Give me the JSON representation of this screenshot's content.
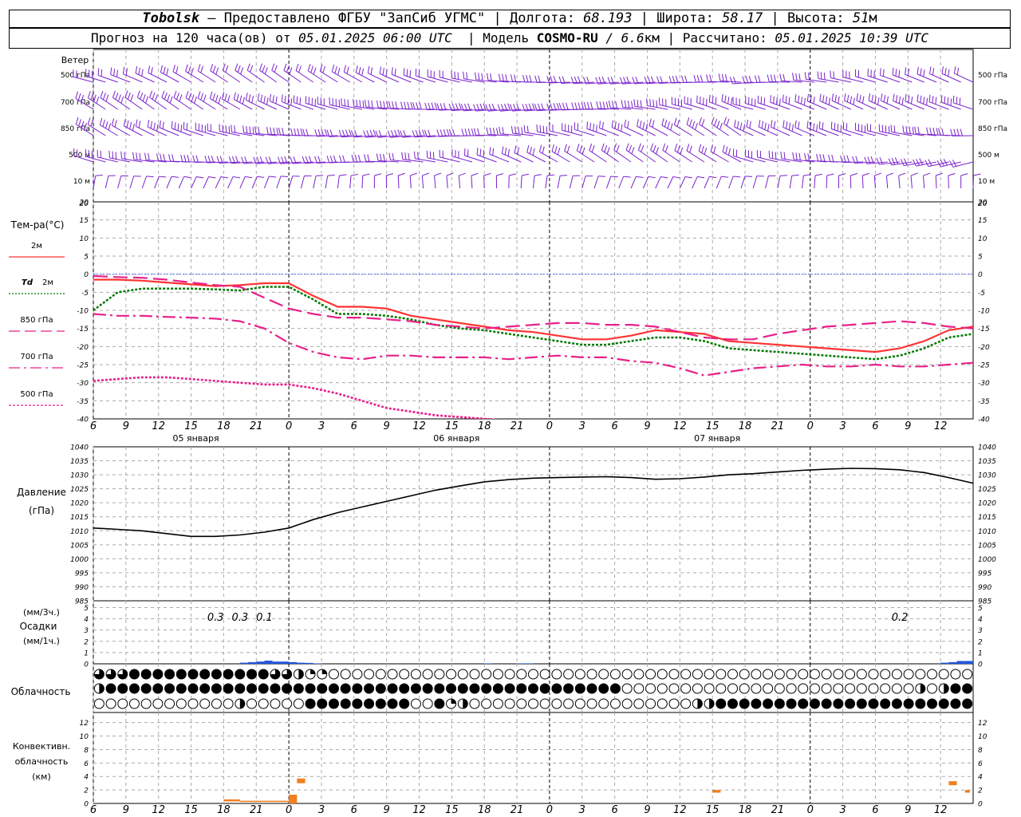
{
  "header": {
    "station": "Tobolsk",
    "dash": " — ",
    "provider": "Предоставлено ФГБУ \"ЗапСиб УГМС\"",
    "lon_label": "Долгота: ",
    "lon": "68.193",
    "lat_label": "Широта: ",
    "lat": "58.17",
    "alt_label": "Высота: ",
    "alt": "51",
    "alt_unit": "м",
    "forecast_label": "Прогноз на 120 часа(ов) от ",
    "forecast_start": "05.01.2025 06:00 UTC",
    "model_label": "Модель ",
    "model": "COSMO-RU",
    "model_res": " / 6.6",
    "model_res_unit": "км",
    "calc_label": "Рассчитано: ",
    "calc_time": "05.01.2025 10:39 UTC"
  },
  "colors": {
    "t2m": "#ff3333",
    "td2m": "#007700",
    "t850": "#e8208a",
    "t700": "#e8208a",
    "t500": "#e8208a",
    "wind": "#7a22cc",
    "pressure": "#000000",
    "precip": "#2255dd",
    "convective": "#f08020",
    "grid": "#aaaaaa",
    "zero_line": "#5566ff"
  },
  "wind_panel": {
    "title": "Ветер",
    "levels": [
      "500 гПа",
      "700 гПа",
      "850 гПа",
      "500 м",
      "10 м"
    ],
    "icon": "wind-barb-icon"
  },
  "time_axis": {
    "ticks": [
      "6",
      "9",
      "12",
      "15",
      "18",
      "21",
      "0",
      "3",
      "6",
      "9",
      "12",
      "15",
      "18",
      "21",
      "0",
      "3",
      "6",
      "9",
      "12",
      "15",
      "18",
      "21",
      "0",
      "3",
      "6",
      "9",
      "12"
    ],
    "days": [
      {
        "label": "05 января",
        "tick_index": 3
      },
      {
        "label": "06 января",
        "tick_index": 11
      },
      {
        "label": "07 января",
        "tick_index": 19
      }
    ],
    "midnight_tick_indices": [
      6,
      14,
      22
    ]
  },
  "temp_panel": {
    "title": "Тем-ра(°C)",
    "legend": [
      {
        "label": "2м",
        "style": "solid",
        "color_key": "t2m"
      },
      {
        "label": "Td",
        "suffix": "2м",
        "style": "dotted",
        "color_key": "td2m"
      },
      {
        "label": "850 гПа",
        "style": "dashed",
        "color_key": "t850"
      },
      {
        "label": "700 гПа",
        "style": "dashdot",
        "color_key": "t700"
      },
      {
        "label": "500 гПа",
        "style": "finedot",
        "color_key": "t500"
      }
    ],
    "yticks": [
      20,
      15,
      10,
      5,
      0,
      -5,
      -10,
      -15,
      -20,
      -25,
      -30,
      -35,
      -40
    ]
  },
  "pressure_panel": {
    "title": "Давление",
    "unit": "(гПа)",
    "yticks": [
      1040,
      1035,
      1030,
      1025,
      1020,
      1015,
      1010,
      1005,
      1000,
      995,
      990,
      985
    ]
  },
  "precip_panel": {
    "unit_top": "(мм/3ч.)",
    "title": "Осадки",
    "unit_bottom": "(мм/1ч.)",
    "yticks": [
      5,
      4,
      3,
      2,
      1,
      0
    ],
    "annotations": [
      {
        "hour": 21,
        "text": "0.3"
      },
      {
        "hour": 24,
        "text": "0.3"
      },
      {
        "hour": 27,
        "text": "0.1"
      },
      {
        "hour": 105,
        "text": "0.2"
      }
    ]
  },
  "cloud_panel": {
    "title": "Облачность",
    "icon": "cloud-cover-icon"
  },
  "convective_panel": {
    "title_1": "Конвективн.",
    "title_2": "облачность",
    "unit": "(км)",
    "yticks": [
      12,
      10,
      8,
      6,
      4,
      2,
      0
    ]
  },
  "chart_data": [
    {
      "type": "line",
      "title": "Тем-ра(°C)",
      "x_unit": "hours since 05.01.2025 06:00 UTC",
      "ylim": [
        -40,
        20
      ],
      "grid": true,
      "series": [
        {
          "name": "2м",
          "x": [
            0,
            3,
            6,
            9,
            12,
            15,
            18,
            21,
            24,
            27,
            30,
            33,
            36,
            39,
            42,
            45,
            48,
            51,
            54,
            57,
            60,
            63,
            66,
            69,
            72,
            75,
            78,
            81,
            84,
            87,
            90,
            93,
            96,
            99,
            102,
            105,
            108
          ],
          "values": [
            -1.5,
            -1.5,
            -1.8,
            -2.3,
            -2.8,
            -3.3,
            -3.0,
            -2.5,
            -2.5,
            -6,
            -9,
            -9,
            -9.5,
            -11.5,
            -12.5,
            -13.5,
            -14.5,
            -15.5,
            -16,
            -17,
            -18,
            -18,
            -17,
            -15.5,
            -16,
            -16.5,
            -18.5,
            -19,
            -19.5,
            -20,
            -20.5,
            -21,
            -21.5,
            -20.5,
            -18.5,
            -15.5,
            -14.5
          ]
        },
        {
          "name": "Td 2м",
          "x": [
            0,
            3,
            6,
            9,
            12,
            15,
            18,
            21,
            24,
            27,
            30,
            33,
            36,
            39,
            42,
            45,
            48,
            51,
            54,
            57,
            60,
            63,
            66,
            69,
            72,
            75,
            78,
            81,
            84,
            87,
            90,
            93,
            96,
            99,
            102,
            105,
            108
          ],
          "values": [
            -10,
            -5,
            -4,
            -4,
            -4,
            -4.2,
            -4.5,
            -3.5,
            -3.5,
            -7,
            -11,
            -11,
            -11.5,
            -12.5,
            -14,
            -15,
            -15.5,
            -16.5,
            -17.5,
            -18.5,
            -19.5,
            -19.5,
            -18.5,
            -17.5,
            -17.5,
            -18.5,
            -20.5,
            -21,
            -21.5,
            -22,
            -22.5,
            -23,
            -23.5,
            -22.5,
            -20.5,
            -17.5,
            -16.5
          ]
        },
        {
          "name": "850 гПа",
          "x": [
            0,
            3,
            6,
            9,
            12,
            15,
            18,
            21,
            24,
            27,
            30,
            33,
            36,
            39,
            42,
            45,
            48,
            51,
            54,
            57,
            60,
            63,
            66,
            69,
            72,
            75,
            78,
            81,
            84,
            87,
            90,
            93,
            96,
            99,
            102,
            105,
            108
          ],
          "values": [
            -0.5,
            -0.8,
            -1,
            -1.5,
            -2.3,
            -3,
            -3.5,
            -6.5,
            -9.5,
            -11,
            -12,
            -12,
            -12.5,
            -13,
            -14,
            -14.5,
            -15,
            -14.5,
            -14,
            -13.5,
            -13.5,
            -14,
            -14,
            -14.5,
            -16,
            -17.5,
            -18,
            -18,
            -16.5,
            -15.5,
            -14.5,
            -14,
            -13.5,
            -13,
            -13.5,
            -14.5,
            -15
          ]
        },
        {
          "name": "700 гПа",
          "x": [
            0,
            3,
            6,
            9,
            12,
            15,
            18,
            21,
            24,
            27,
            30,
            33,
            36,
            39,
            42,
            45,
            48,
            51,
            54,
            57,
            60,
            63,
            66,
            69,
            72,
            75,
            78,
            81,
            84,
            87,
            90,
            93,
            96,
            99,
            102,
            105,
            108
          ],
          "values": [
            -11,
            -11.5,
            -11.5,
            -11.8,
            -12,
            -12.3,
            -13,
            -15,
            -19,
            -21.5,
            -23,
            -23.5,
            -22.5,
            -22.5,
            -23,
            -23,
            -23,
            -23.5,
            -23,
            -22.5,
            -23,
            -23,
            -24,
            -24.5,
            -26,
            -28,
            -27,
            -26,
            -25.5,
            -25,
            -25.5,
            -25.5,
            -25,
            -25.5,
            -25.5,
            -25,
            -24.5
          ]
        },
        {
          "name": "500 гПа",
          "x": [
            0,
            3,
            6,
            9,
            12,
            15,
            18,
            21,
            24,
            27,
            30,
            33,
            36,
            39,
            42,
            45,
            48,
            51,
            54
          ],
          "values": [
            -29.5,
            -29,
            -28.5,
            -28.5,
            -29,
            -29.5,
            -30,
            -30.5,
            -30.5,
            -31.5,
            -33,
            -35,
            -37,
            -38,
            -39,
            -39.5,
            -40,
            -40.5,
            -41
          ]
        }
      ]
    },
    {
      "type": "line",
      "title": "Давление",
      "ylabel": "(гПа)",
      "x_unit": "hours since 05.01.2025 06:00 UTC",
      "ylim": [
        985,
        1040
      ],
      "grid": true,
      "series": [
        {
          "name": "",
          "x": [
            0,
            3,
            6,
            9,
            12,
            15,
            18,
            21,
            24,
            27,
            30,
            33,
            36,
            39,
            42,
            45,
            48,
            51,
            54,
            57,
            60,
            63,
            66,
            69,
            72,
            75,
            78,
            81,
            84,
            87,
            90,
            93,
            96,
            99,
            102,
            105,
            108
          ],
          "values": [
            1011,
            1010.5,
            1010,
            1009,
            1008,
            1008,
            1008.5,
            1009.5,
            1011,
            1014,
            1016.5,
            1018.5,
            1020.5,
            1022.5,
            1024.5,
            1026,
            1027.5,
            1028.3,
            1028.8,
            1029,
            1029.2,
            1029.3,
            1029,
            1028.4,
            1028.6,
            1029.2,
            1030,
            1030.4,
            1031,
            1031.6,
            1032,
            1032.3,
            1032.2,
            1031.8,
            1030.8,
            1029,
            1027
          ]
        }
      ]
    },
    {
      "type": "bar",
      "title": "Осадки",
      "ylabel": "(мм/1ч.)",
      "x_unit": "hours since 05.01.2025 06:00 UTC",
      "ylim": [
        0,
        5
      ],
      "series": [
        {
          "name": "",
          "x": [
            18,
            19,
            20,
            21,
            22,
            23,
            24,
            25,
            26,
            27,
            48,
            52,
            53,
            104,
            105,
            106,
            107
          ],
          "values": [
            0.1,
            0.15,
            0.2,
            0.28,
            0.2,
            0.2,
            0.15,
            0.1,
            0.08,
            0.04,
            0.04,
            0.04,
            0.04,
            0.1,
            0.15,
            0.25,
            0.25
          ]
        }
      ]
    },
    {
      "type": "table",
      "title": "Облачность",
      "x_unit": "hours since 05.01.2025 06:00 UTC",
      "rows": [
        "upper",
        "middle",
        "lower"
      ],
      "value_meaning": "cloud fraction 0-1 at each hour (drawn as filled circle)",
      "columns_every_hours": 1.5,
      "upper": "3,3,3,4,4,4,4,4,4,4,4,4,4,4,4,3,3,2,1,1,0,0,0,0,0,0,0,0,0,0,0,0,0,0,0,0,0,0,0,0,0,0,0,0,0,0,0,0,0,0,0,0,0,0,0,0,0,0,0,0,0,0,0,0,0,0,0,0,0,0,0,0,0,0,0",
      "middle": "2,4,4,4,4,4,4,4,4,4,4,4,4,4,4,4,4,4,4,4,4,4,4,4,4,4,4,4,4,4,4,4,4,4,4,4,4,4,4,4,4,4,4,4,4,0,0,0,0,0,0,0,0,0,0,0,0,0,0,0,0,0,0,0,0,0,0,0,0,0,2,0,2,4,4,4,4",
      "lower": "0,0,0,0,0,0,0,0,0,0,0,0,2,0,0,0,0,0,4,4,4,4,4,4,4,4,4,0,0,4,1,2,0,0,0,0,0,0,0,0,0,0,0,0,0,0,0,0,0,0,0,2,2,4,4,4,4,4,4,4,4,4,4,4,4,4,4,4,4,4,4,4,4,4,4,4,4,4,4,4,4,4,4,4"
    },
    {
      "type": "bar",
      "title": "Конвективн. облачность",
      "ylabel": "(км)",
      "x_unit": "hours since 05.01.2025 06:00 UTC",
      "ylim": [
        0,
        13
      ],
      "series": [
        {
          "name": "",
          "segments": [
            {
              "x0": 16,
              "x1": 18,
              "bottom": 0.3,
              "top": 0.6
            },
            {
              "x0": 18,
              "x1": 24,
              "bottom": 0.3,
              "top": 0.4
            },
            {
              "x0": 24,
              "x1": 25,
              "bottom": 0.0,
              "top": 1.3
            },
            {
              "x0": 25,
              "x1": 26,
              "bottom": 3.0,
              "top": 3.7
            },
            {
              "x0": 76,
              "x1": 77,
              "bottom": 1.6,
              "top": 2.0
            },
            {
              "x0": 105,
              "x1": 106,
              "bottom": 2.7,
              "top": 3.3
            },
            {
              "x0": 107,
              "x1": 107.6,
              "bottom": 1.6,
              "top": 2.0
            }
          ]
        }
      ]
    }
  ]
}
